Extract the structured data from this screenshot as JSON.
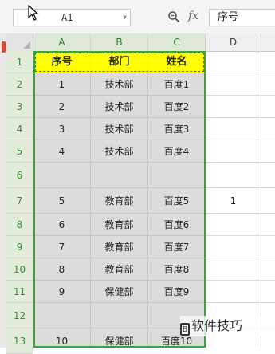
{
  "formula_bar": {
    "name_box_value": "A1",
    "fx_label": "fx",
    "formula_value": "序号"
  },
  "columns": [
    "A",
    "B",
    "C",
    "D"
  ],
  "rows": [
    "1",
    "2",
    "3",
    "4",
    "5",
    "6",
    "7",
    "8",
    "9",
    "10",
    "11",
    "12",
    "13"
  ],
  "headers": {
    "A": "序号",
    "B": "部门",
    "C": "姓名"
  },
  "data_rows": [
    {
      "a": "1",
      "b": "技术部",
      "c": "百度1",
      "d": ""
    },
    {
      "a": "2",
      "b": "技术部",
      "c": "百度2",
      "d": ""
    },
    {
      "a": "3",
      "b": "技术部",
      "c": "百度3",
      "d": ""
    },
    {
      "a": "4",
      "b": "技术部",
      "c": "百度4",
      "d": ""
    },
    {
      "a": "",
      "b": "",
      "c": "",
      "d": ""
    },
    {
      "a": "5",
      "b": "教育部",
      "c": "百度5",
      "d": "1"
    },
    {
      "a": "6",
      "b": "教育部",
      "c": "百度6",
      "d": ""
    },
    {
      "a": "7",
      "b": "教育部",
      "c": "百度7",
      "d": ""
    },
    {
      "a": "8",
      "b": "教育部",
      "c": "百度8",
      "d": ""
    },
    {
      "a": "9",
      "b": "保健部",
      "c": "百度9",
      "d": ""
    },
    {
      "a": "",
      "b": "",
      "c": "",
      "d": ""
    },
    {
      "a": "10",
      "b": "保健部",
      "c": "百度10",
      "d": ""
    }
  ],
  "watermark": {
    "glyph": "B",
    "text": "软件技巧"
  },
  "colors": {
    "header_fill": "#ffff00",
    "selection_fill": "#dcdcdc",
    "selection_border": "#3aa33a"
  }
}
